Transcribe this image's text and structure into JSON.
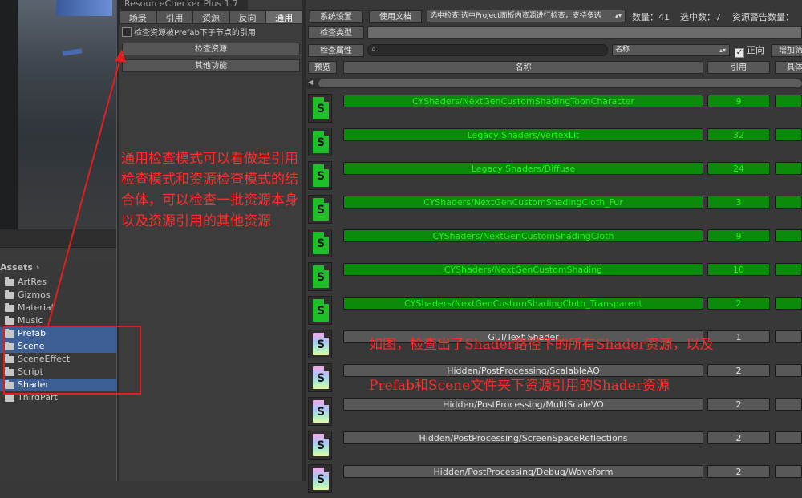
{
  "window": {
    "title": "ResourceChecker Plus 1.7"
  },
  "mode_tabs": [
    {
      "label": "场景",
      "active": false
    },
    {
      "label": "引用",
      "active": false
    },
    {
      "label": "资源",
      "active": false
    },
    {
      "label": "反向",
      "active": false
    },
    {
      "label": "通用",
      "active": true
    }
  ],
  "options": {
    "prefab_check_label": "检查资源被Prefab下子节点的引用",
    "prefab_check_checked": false,
    "check_resources_button": "检查资源",
    "other_functions_button": "其他功能"
  },
  "assets": {
    "header": "Assets",
    "folders": [
      {
        "label": "ArtRes",
        "selected": false
      },
      {
        "label": "Gizmos",
        "selected": false
      },
      {
        "label": "Material",
        "selected": false
      },
      {
        "label": "Music",
        "selected": false
      },
      {
        "label": "Prefab",
        "selected": true
      },
      {
        "label": "Scene",
        "selected": true
      },
      {
        "label": "SceneEffect",
        "selected": false
      },
      {
        "label": "Script",
        "selected": false
      },
      {
        "label": "Shader",
        "selected": true
      },
      {
        "label": "ThirdPart",
        "selected": false
      }
    ]
  },
  "toolbar": {
    "settings_button": "系统设置",
    "docs_button": "使用文档",
    "scope_select_value": "选中检查,选中Project面板内资源进行检查，支持多选",
    "count_label": "数量：41",
    "selected_label": "选中数：7",
    "warning_label": "资源警告数量：",
    "check_type_button": "检查类型",
    "check_property_button": "检查属性",
    "search_placeholder": "",
    "sort_select_value": "名称",
    "forward_label": "正向",
    "forward_checked": true,
    "add_filter_button": "增加筛"
  },
  "columns": {
    "preview": "预览",
    "name": "名称",
    "reference": "引用",
    "extra": "具体"
  },
  "rows": [
    {
      "name": "CYShaders/NextGenCustomShadingToonCharacter",
      "ref": "9",
      "highlight": true
    },
    {
      "name": "Legacy Shaders/VertexLit",
      "ref": "32",
      "highlight": true
    },
    {
      "name": "Legacy Shaders/Diffuse",
      "ref": "24",
      "highlight": true
    },
    {
      "name": "CYShaders/NextGenCustomShadingCloth_Fur",
      "ref": "3",
      "highlight": true
    },
    {
      "name": "CYShaders/NextGenCustomShadingCloth",
      "ref": "9",
      "highlight": true
    },
    {
      "name": "CYShaders/NextGenCustomShading",
      "ref": "10",
      "highlight": true
    },
    {
      "name": "CYShaders/NextGenCustomShadingCloth_Transparent",
      "ref": "2",
      "highlight": true
    },
    {
      "name": "GUI/Text Shader",
      "ref": "1",
      "highlight": false
    },
    {
      "name": "Hidden/PostProcessing/ScalableAO",
      "ref": "2",
      "highlight": false
    },
    {
      "name": "Hidden/PostProcessing/MultiScaleVO",
      "ref": "2",
      "highlight": false
    },
    {
      "name": "Hidden/PostProcessing/ScreenSpaceReflections",
      "ref": "2",
      "highlight": false
    },
    {
      "name": "Hidden/PostProcessing/Debug/Waveform",
      "ref": "2",
      "highlight": false
    }
  ],
  "annotations": {
    "left_note": "通用检查模式可以看做是引用检查模式和资源检查模式的结合体，可以检查一批资源本身以及资源引用的其他资源",
    "right_note_line1": "如图，检查出了Shader路径下的所有Shader资源，以及",
    "right_note_line2": "Prefab和Scene文件夹下资源引用的Shader资源",
    "color": "#ff2b2b"
  }
}
